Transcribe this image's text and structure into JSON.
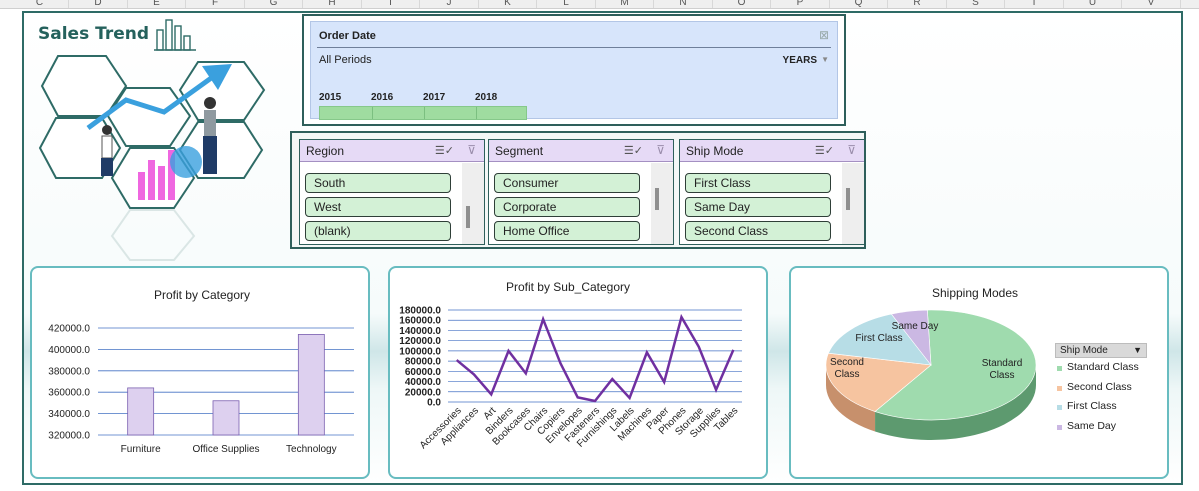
{
  "sheet": {
    "columns": [
      "C",
      "D",
      "E",
      "F",
      "G",
      "H",
      "I",
      "J",
      "K",
      "L",
      "M",
      "N",
      "O",
      "P",
      "Q",
      "R",
      "S",
      "T",
      "U",
      "V"
    ]
  },
  "dashboard": {
    "title": "Sales Trend"
  },
  "timeline": {
    "title": "Order Date",
    "period_label": "All Periods",
    "level": "YEARS",
    "years": [
      "2015",
      "2016",
      "2017",
      "2018"
    ]
  },
  "slicers": [
    {
      "title": "Region",
      "items": [
        "South",
        "West",
        "(blank)"
      ]
    },
    {
      "title": "Segment",
      "items": [
        "Consumer",
        "Corporate",
        "Home Office"
      ]
    },
    {
      "title": "Ship Mode",
      "items": [
        "First Class",
        "Same Day",
        "Second Class"
      ]
    }
  ],
  "colors": {
    "accent": "#24615c",
    "slicer_item": "#d3f1d6",
    "slicer_header": "#e6daf6",
    "timeline_bg": "#d7e5fb",
    "timeline_bar": "#9fdca0",
    "bar_fill": "#ddd0ef",
    "line_stroke": "#7030a0",
    "pie_standard": "#9fdbae",
    "pie_second": "#f6c4a0",
    "pie_first": "#b7dde6",
    "pie_sameday": "#cbb8e3"
  },
  "chart_data": [
    {
      "type": "bar",
      "title": "Profit  by Category",
      "categories": [
        "Furniture",
        "Office Supplies",
        "Technology"
      ],
      "values": [
        364000,
        352000,
        414000
      ],
      "ylim": [
        320000,
        420000
      ],
      "yticks": [
        "420000.0",
        "400000.0",
        "380000.0",
        "360000.0",
        "340000.0",
        "320000.0"
      ],
      "grid": true
    },
    {
      "type": "line",
      "title": "Profit by Sub_Category",
      "categories": [
        "Accessories",
        "Appliances",
        "Art",
        "Binders",
        "Bookcases",
        "Chairs",
        "Copiers",
        "Envelopes",
        "Fasteners",
        "Furnishings",
        "Labels",
        "Machines",
        "Paper",
        "Phones",
        "Storage",
        "Supplies",
        "Tables"
      ],
      "values": [
        82000,
        54000,
        15000,
        100000,
        56000,
        162000,
        76000,
        9000,
        2000,
        45000,
        8000,
        97000,
        39000,
        166000,
        108000,
        24000,
        102000
      ],
      "ylim": [
        0,
        180000
      ],
      "yticks": [
        "180000.0",
        "160000.0",
        "140000.0",
        "120000.0",
        "100000.0",
        "80000.0",
        "60000.0",
        "40000.0",
        "20000.0",
        "0.0"
      ],
      "grid": true
    },
    {
      "type": "pie",
      "title": "Shipping Modes",
      "categories": [
        "Standard Class",
        "Second Class",
        "First Class",
        "Same Day"
      ],
      "values": [
        59.5,
        19.5,
        15.4,
        5.6
      ],
      "legend_title": "Ship Mode",
      "legend": "right"
    }
  ]
}
